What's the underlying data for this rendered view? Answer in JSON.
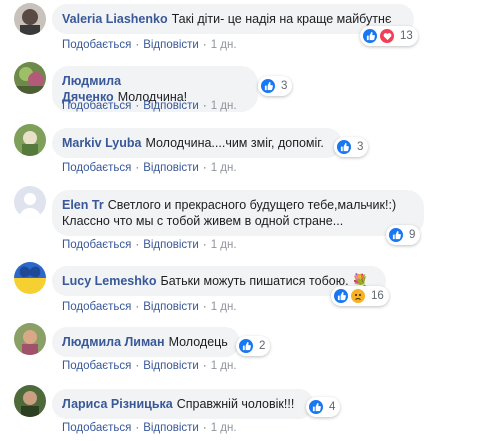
{
  "actions": {
    "like": "Подобається",
    "reply": "Відповісти"
  },
  "comments": [
    {
      "author": "Valeria Liashenko",
      "text": "Такі діти- це надія на краще майбутнє",
      "time": "1 дн.",
      "reactions": [
        "like",
        "love"
      ],
      "count": "13"
    },
    {
      "author": "Людмила Дяченко",
      "text": "Молодчина!",
      "time": "1 дн.",
      "reactions": [
        "like"
      ],
      "count": "3"
    },
    {
      "author": "Markiv Lyuba",
      "text": "Молодчина....чим зміг, допомiг.",
      "time": "1 дн.",
      "reactions": [
        "like"
      ],
      "count": "3"
    },
    {
      "author": "Elen Tr",
      "text": "Светлого и прекрасного будущего тебе,мальчик!:) Классно что мы с тобой живем в одной стране...",
      "time": "1 дн.",
      "reactions": [
        "like"
      ],
      "count": "9"
    },
    {
      "author": "Lucy Lemeshko",
      "text": "Батьки можуть пишатися тобою.",
      "sticker": "💐",
      "time": "1 дн.",
      "reactions": [
        "like",
        "sad"
      ],
      "count": "16"
    },
    {
      "author": "Людмила Лиман",
      "text": "Молодець",
      "time": "1 дн.",
      "reactions": [
        "like"
      ],
      "count": "2"
    },
    {
      "author": "Лариса Різницька",
      "text": "Справжній чоловік!!!",
      "time": "1 дн.",
      "reactions": [
        "like"
      ],
      "count": "4"
    }
  ],
  "colors": {
    "author": "#385898",
    "bubble": "#f2f3f5",
    "like": "#1877f2",
    "love": "#f33e58",
    "sad": "#f7b125"
  }
}
